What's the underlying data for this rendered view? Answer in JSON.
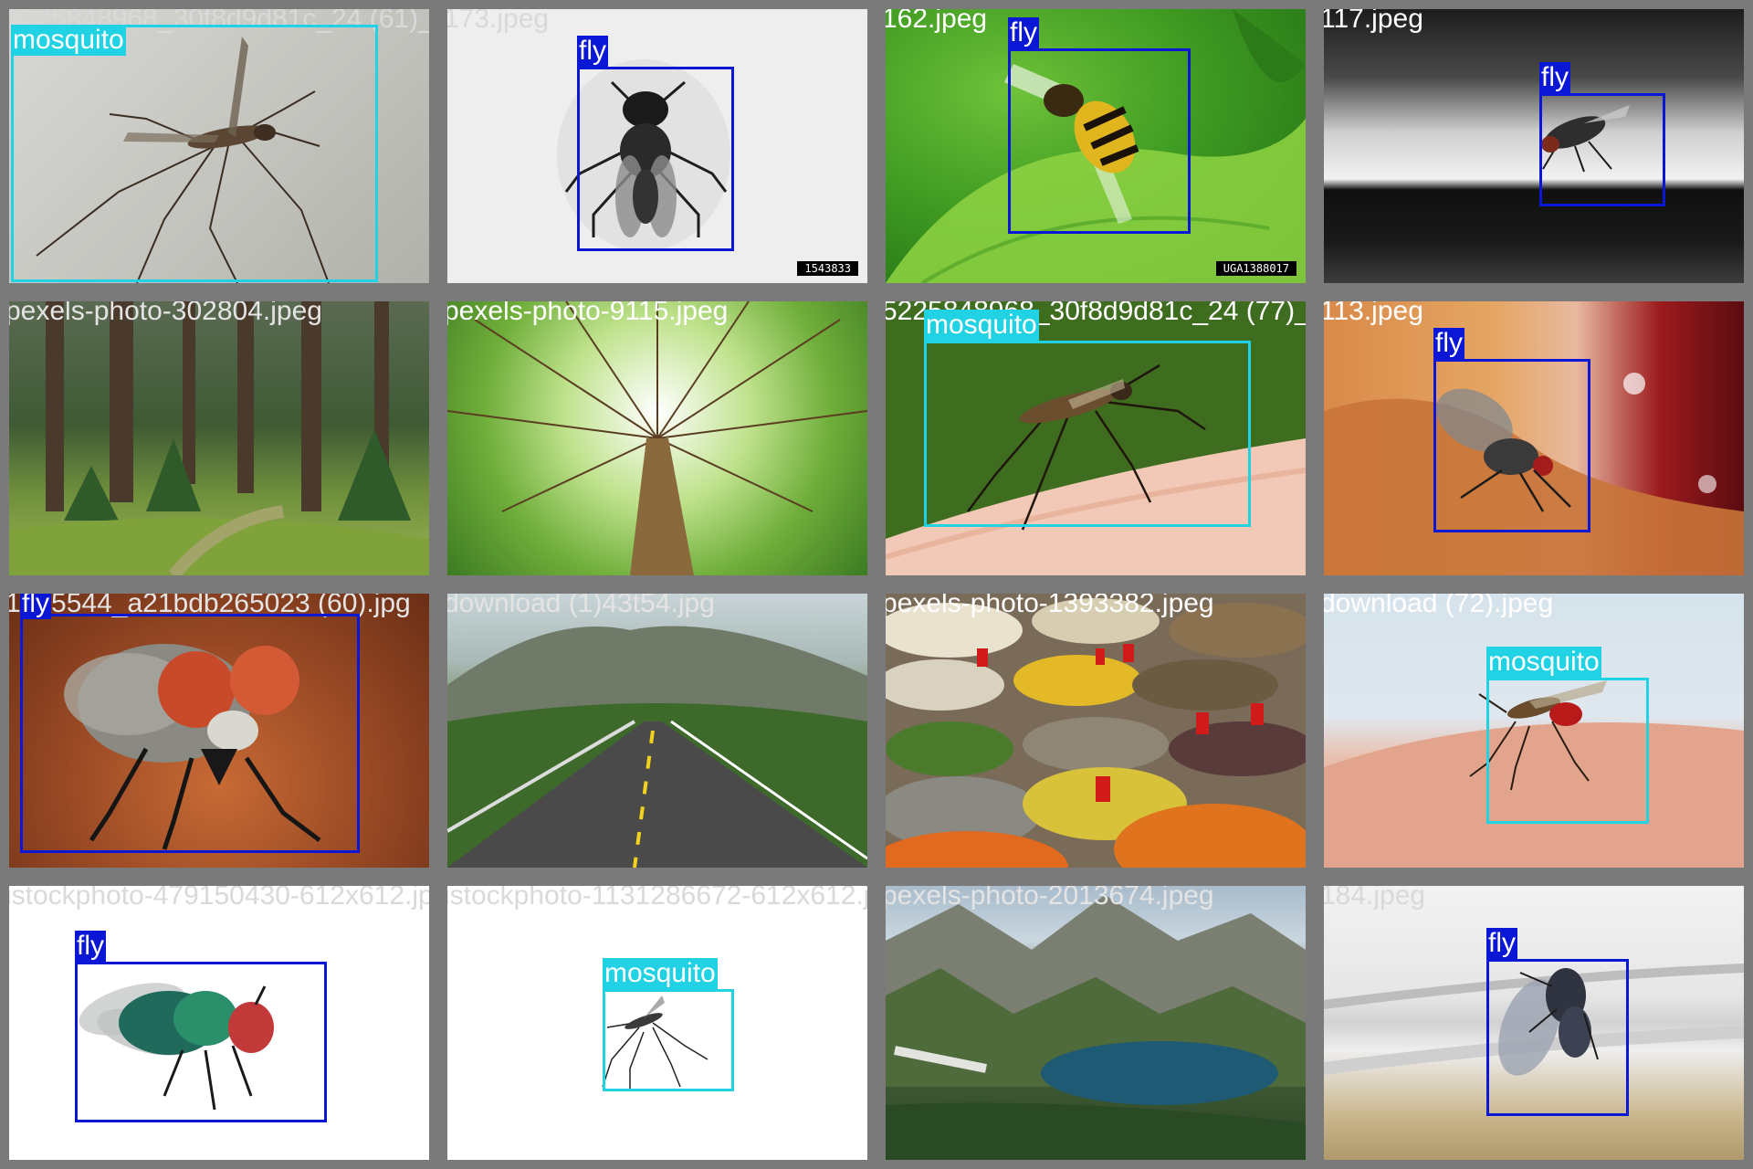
{
  "colors": {
    "fly": "#0a18d6",
    "mosquito": "#20d2e4",
    "border": "#7a7a7a"
  },
  "tiles": [
    {
      "file": "5225848968_30f8d9d81c_24 (61)_jpg.jpeg",
      "scene": "insect-on-stone",
      "label": "mosquito",
      "cls": "mosquito"
    },
    {
      "file": "173.jpeg",
      "scene": "fly-on-white",
      "label": "fly",
      "cls": "fly",
      "stamp": "1543833"
    },
    {
      "file": "162.jpeg",
      "scene": "hoverfly-on-leaf",
      "label": "fly",
      "cls": "fly",
      "stamp": "UGA1388017"
    },
    {
      "file": "117.jpeg",
      "scene": "fly-on-window-sill",
      "label": "fly",
      "cls": "fly"
    },
    {
      "file": "pexels-photo-302804.jpeg",
      "scene": "pine-forest",
      "label": null,
      "cls": null
    },
    {
      "file": "pexels-photo-9115.jpeg",
      "scene": "tree-canopy",
      "label": null,
      "cls": null
    },
    {
      "file": "5225848968_30f8d9d81c_24 (77)_jpg.jpeg",
      "scene": "mosquito-on-skin-green",
      "label": "mosquito",
      "cls": "mosquito"
    },
    {
      "file": "113.jpeg",
      "scene": "fly-on-food",
      "label": "fly",
      "cls": "fly"
    },
    {
      "file": "1255544_a21bdb265023 (60).jpg",
      "scene": "fly-closeup",
      "label": "fly",
      "cls": "fly"
    },
    {
      "file": "download (1)43t54.jpg",
      "scene": "mountain-road",
      "label": null,
      "cls": null
    },
    {
      "file": "pexels-photo-1393382.jpeg",
      "scene": "spice-market",
      "label": null,
      "cls": null
    },
    {
      "file": "download (72).jpeg",
      "scene": "mosquito-on-arm",
      "label": "mosquito",
      "cls": "mosquito"
    },
    {
      "file": "istockphoto-479150430-612x612.jpg",
      "scene": "green-bottle-fly",
      "label": "fly",
      "cls": "fly"
    },
    {
      "file": "istockphoto-1131286672-612x612.jpg",
      "scene": "mosquito-on-white",
      "label": "mosquito",
      "cls": "mosquito"
    },
    {
      "file": "pexels-photo-2013674.jpeg",
      "scene": "mountain-lake",
      "label": null,
      "cls": null
    },
    {
      "file": "184.jpeg",
      "scene": "fly-on-white-frame",
      "label": "fly",
      "cls": "fly"
    }
  ]
}
